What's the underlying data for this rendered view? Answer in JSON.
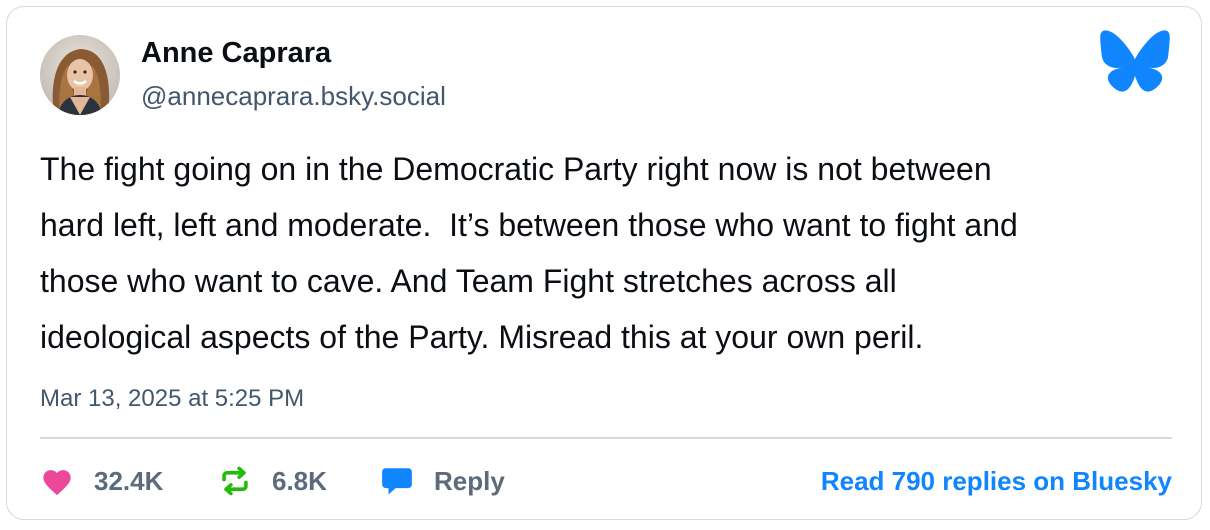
{
  "author": {
    "name": "Anne Caprara",
    "handle": "@annecaprara.bsky.social"
  },
  "post": {
    "text": "The fight going on in the Democratic Party right now is not between\nhard left, left and moderate.  It’s between those who want to fight and\nthose who want to cave. And Team Fight stretches across all\nideological aspects of the Party. Misread this at your own peril.",
    "timestamp": "Mar 13, 2025 at 5:25 PM"
  },
  "actions": {
    "likes": "32.4K",
    "reposts": "6.8K",
    "reply_label": "Reply",
    "read_replies": "Read 790 replies on Bluesky"
  },
  "icons": {
    "logo": "bluesky-butterfly-icon",
    "like": "heart-icon",
    "repost": "repost-icon",
    "reply": "speech-bubble-icon"
  },
  "colors": {
    "accent": "#1185fe",
    "like": "#ec4899",
    "repost": "#20bc07",
    "text": "#0b0f14",
    "muted": "#42576c",
    "border": "#d4dbe2"
  }
}
